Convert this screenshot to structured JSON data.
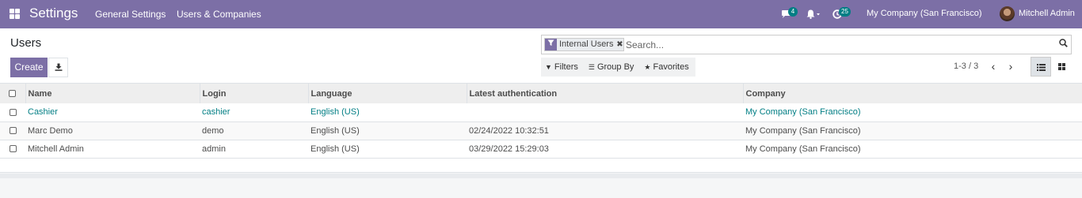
{
  "navbar": {
    "brand": "Settings",
    "menu": [
      "General Settings",
      "Users & Companies"
    ],
    "messages_badge": "4",
    "activities_badge": "25",
    "company": "My Company (San Francisco)",
    "user": "Mitchell Admin"
  },
  "control_panel": {
    "title": "Users",
    "create_label": "Create",
    "search": {
      "facet": "Internal Users",
      "placeholder": "Search..."
    },
    "filters_label": "Filters",
    "group_by_label": "Group By",
    "favorites_label": "Favorites",
    "pager_value": "1-3 / 3"
  },
  "table": {
    "columns": [
      "Name",
      "Login",
      "Language",
      "Latest authentication",
      "Company"
    ],
    "rows": [
      {
        "name": "Cashier",
        "login": "cashier",
        "language": "English (US)",
        "latest_auth": "",
        "company": "My Company (San Francisco)"
      },
      {
        "name": "Marc Demo",
        "login": "demo",
        "language": "English (US)",
        "latest_auth": "02/24/2022 10:32:51",
        "company": "My Company (San Francisco)"
      },
      {
        "name": "Mitchell Admin",
        "login": "admin",
        "language": "English (US)",
        "latest_auth": "03/29/2022 15:29:03",
        "company": "My Company (San Francisco)"
      }
    ]
  },
  "colors": {
    "brand": "#7c6fa6",
    "link": "#017e84",
    "badge": "#017e84"
  },
  "icons": [
    "apps-icon",
    "chat-icon",
    "bell-icon",
    "clock-icon",
    "download-icon",
    "filter-icon",
    "search-icon",
    "list-view-icon",
    "kanban-view-icon"
  ]
}
